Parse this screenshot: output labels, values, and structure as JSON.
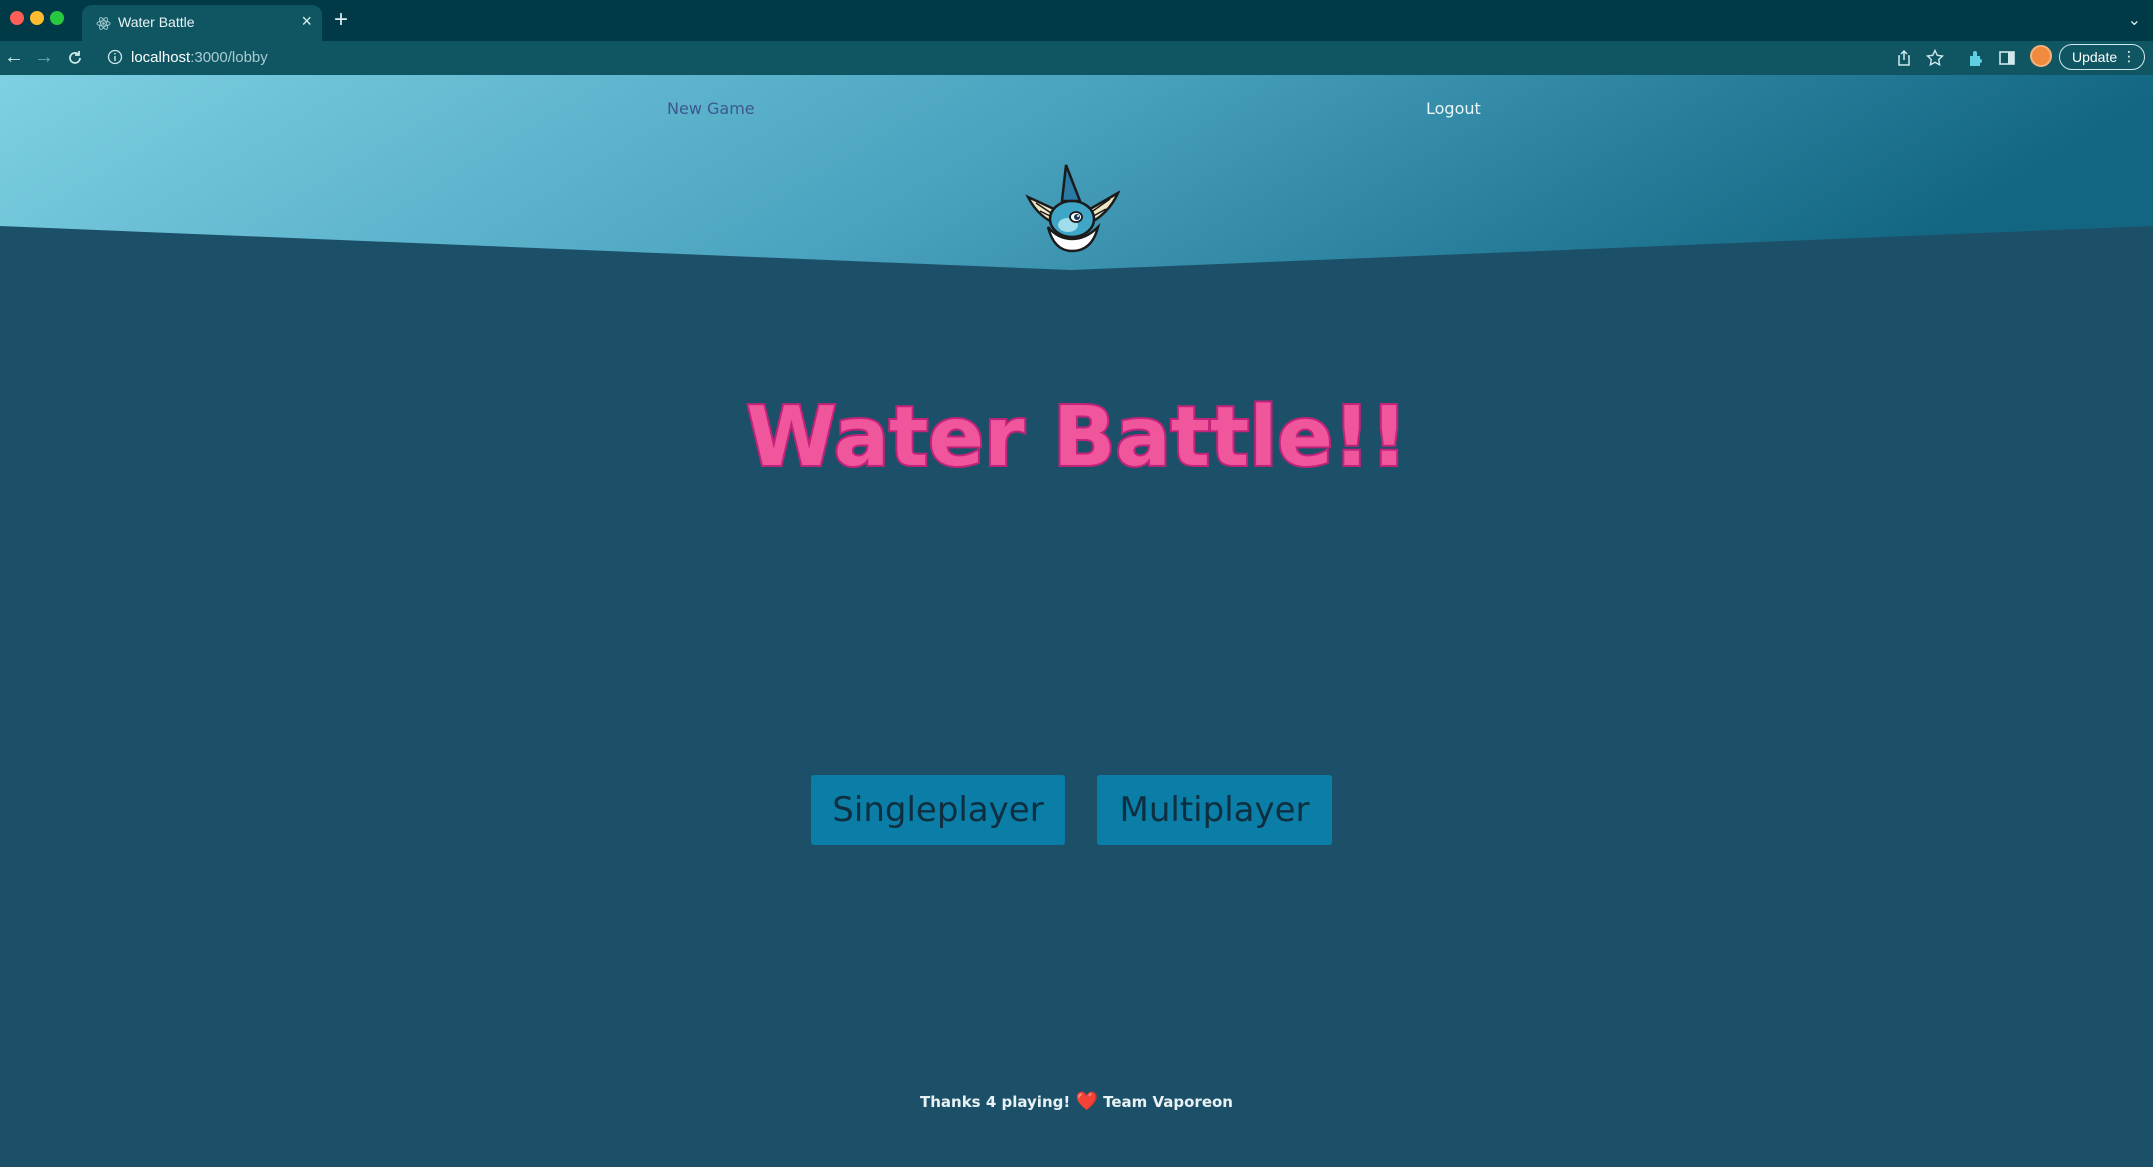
{
  "browser": {
    "tab_title": "Water Battle",
    "tab_close": "×",
    "new_tab": "+",
    "tab_menu": "⌄",
    "url_host": "localhost",
    "url_path": ":3000/lobby",
    "update_label": "Update",
    "menu_dots": "⋮"
  },
  "nav": {
    "new_game": "New Game",
    "logout": "Logout"
  },
  "main": {
    "title": "Water Battle!!",
    "title_color": "#f0569b",
    "singleplayer_label": "Singleplayer",
    "multiplayer_label": "Multiplayer"
  },
  "footer": {
    "text_before": "Thanks 4 playing!",
    "heart": "❤️",
    "text_after": "Team Vaporeon"
  }
}
